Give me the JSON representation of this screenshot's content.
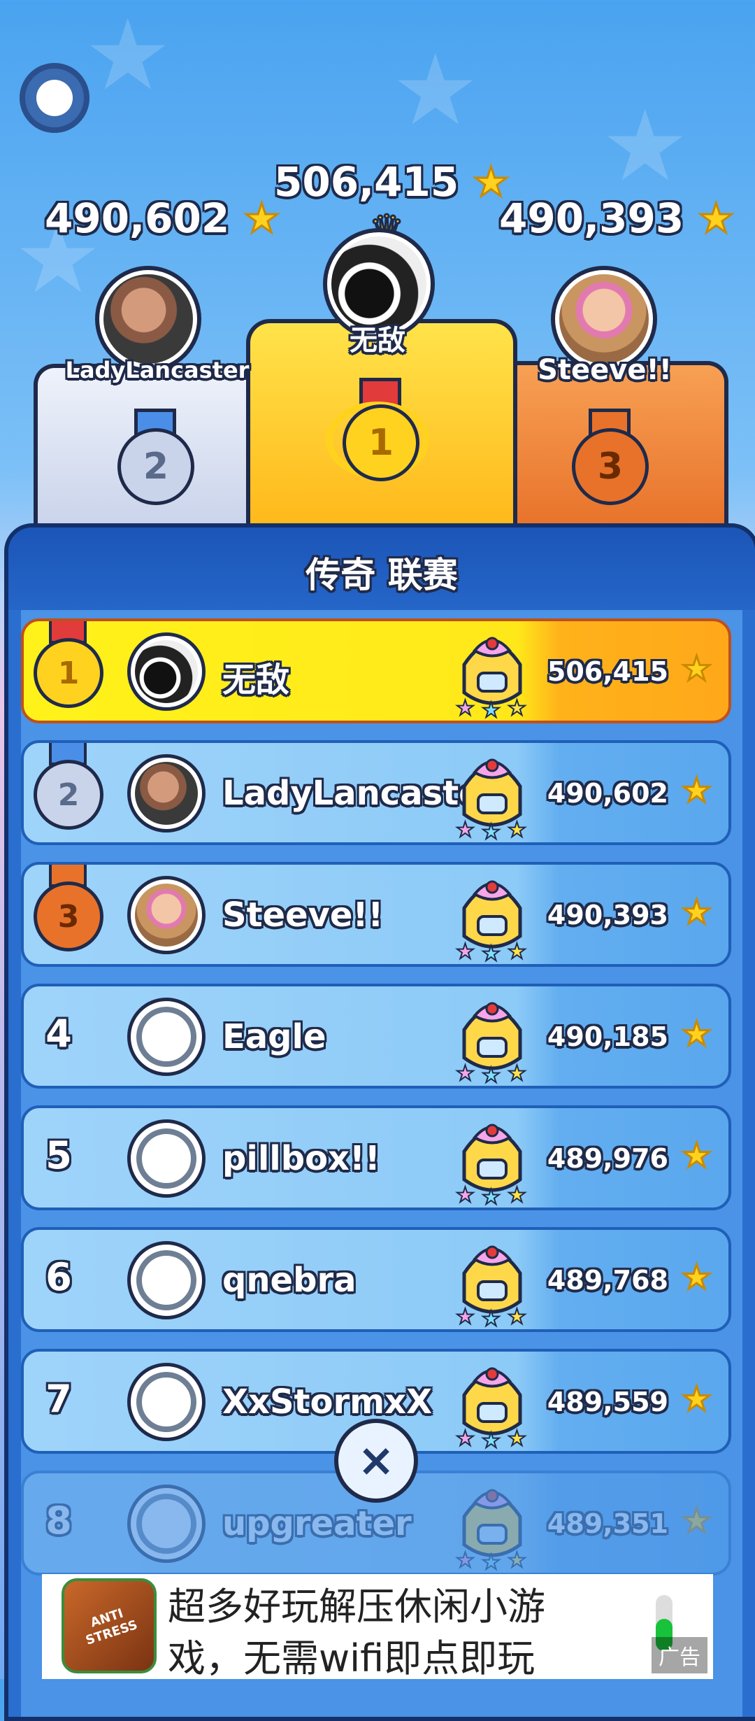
{
  "podium": {
    "first": {
      "score": "506,415",
      "name": "无敌",
      "rank": "1"
    },
    "second": {
      "score": "490,602",
      "name": "LadyLancaster",
      "rank": "2"
    },
    "third": {
      "score": "490,393",
      "name": "Steeve!!",
      "rank": "3"
    }
  },
  "league_title": "传奇 联赛",
  "rows": [
    {
      "rank": "1",
      "name": "无敌",
      "score": "506,415"
    },
    {
      "rank": "2",
      "name": "LadyLancaster",
      "score": "490,602"
    },
    {
      "rank": "3",
      "name": "Steeve!!",
      "score": "490,393"
    },
    {
      "rank": "4",
      "name": "Eagle",
      "score": "490,185"
    },
    {
      "rank": "5",
      "name": "pillbox!!",
      "score": "489,976"
    },
    {
      "rank": "6",
      "name": "qnebra",
      "score": "489,768"
    },
    {
      "rank": "7",
      "name": "XxStormxX",
      "score": "489,559"
    },
    {
      "rank": "8",
      "name": "upgreater",
      "score": "489,351"
    }
  ],
  "close_label": "×",
  "ad": {
    "text": "超多好玩解压休闲小游戏，无需wifi即点即玩",
    "icon_text_1": "ANTI",
    "icon_text_2": "STRESS",
    "label": "广告"
  },
  "colors": {
    "gold": "#ffe81a",
    "silver": "#c9d3ea",
    "bronze": "#e8722a",
    "accent": "#2a6fd0"
  }
}
